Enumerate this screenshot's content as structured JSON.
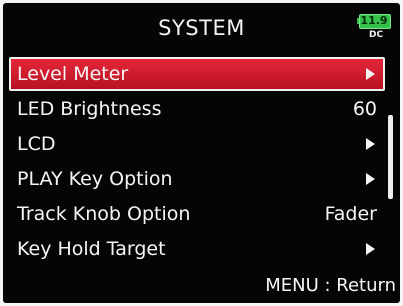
{
  "header": {
    "title": "SYSTEM",
    "battery": {
      "level": "11.9",
      "source": "DC"
    }
  },
  "menu": {
    "items": [
      {
        "label": "Level Meter",
        "value": "",
        "arrow": true,
        "selected": true
      },
      {
        "label": "LED Brightness",
        "value": "60",
        "arrow": false,
        "selected": false
      },
      {
        "label": "LCD",
        "value": "",
        "arrow": true,
        "selected": false
      },
      {
        "label": "PLAY Key Option",
        "value": "",
        "arrow": true,
        "selected": false
      },
      {
        "label": "Track Knob Option",
        "value": "Fader",
        "arrow": false,
        "selected": false
      },
      {
        "label": "Key Hold Target",
        "value": "",
        "arrow": true,
        "selected": false
      }
    ]
  },
  "footer": {
    "hint": "MENU : Return"
  },
  "colors": {
    "screen_bg": "#050505",
    "selection": "#d61d2f",
    "battery": "#35c24a",
    "text": "#f5f5f5"
  },
  "icons": {
    "submenu": "chevron-right-icon",
    "battery": "battery-icon"
  }
}
